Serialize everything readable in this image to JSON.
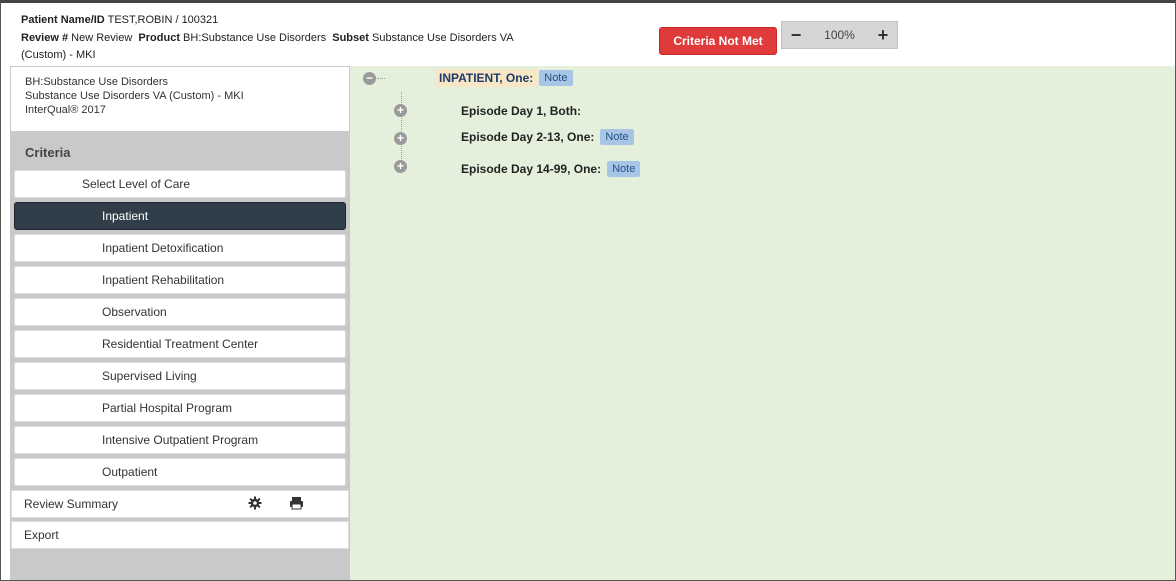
{
  "header": {
    "patient_label": "Patient Name/ID",
    "patient_value": "TEST,ROBIN / 100321",
    "review_label": "Review #",
    "review_value": "New Review",
    "product_label": "Product",
    "product_value": "BH:Substance Use Disorders",
    "subset_label": "Subset",
    "subset_value": "Substance Use Disorders VA",
    "subset_value_cont": "(Custom) - MKI",
    "status_button": "Criteria Not Met",
    "zoom_minus": "−",
    "zoom_value": "100%",
    "zoom_plus": "+"
  },
  "sidebar": {
    "info_line1": "BH:Substance Use Disorders",
    "info_line2": "Substance Use Disorders VA (Custom) - MKI",
    "info_line3": "InterQual® 2017",
    "criteria_title": "Criteria",
    "select_loc": "Select Level of Care",
    "items": [
      {
        "label": "Inpatient",
        "active": true
      },
      {
        "label": "Inpatient Detoxification"
      },
      {
        "label": "Inpatient Rehabilitation"
      },
      {
        "label": "Observation"
      },
      {
        "label": "Residential Treatment Center"
      },
      {
        "label": "Supervised Living"
      },
      {
        "label": "Partial Hospital Program"
      },
      {
        "label": "Intensive Outpatient Program"
      },
      {
        "label": "Outpatient"
      }
    ],
    "review_summary": "Review Summary",
    "gear_icon": "gear-icon",
    "print_icon": "print-icon",
    "export": "Export"
  },
  "tree": {
    "root": {
      "title": "INPATIENT",
      "qualifier": ", One:",
      "note": "Note",
      "toggle": "−"
    },
    "children": [
      {
        "title": "Episode Day 1",
        "qualifier": ", Both:",
        "note": "",
        "toggle": "+"
      },
      {
        "title": "Episode Day 2-13",
        "qualifier": ", One:",
        "note": "Note",
        "toggle": "+"
      },
      {
        "title": "Episode Day 14-99",
        "qualifier": ", One:",
        "note": "Note",
        "toggle": "+"
      }
    ]
  },
  "colors": {
    "main_bg": "#e4f0dc",
    "criteria_not_met": "#e03b3b",
    "active_nav": "#2f3e48",
    "note_bg": "#a9c5e6"
  }
}
